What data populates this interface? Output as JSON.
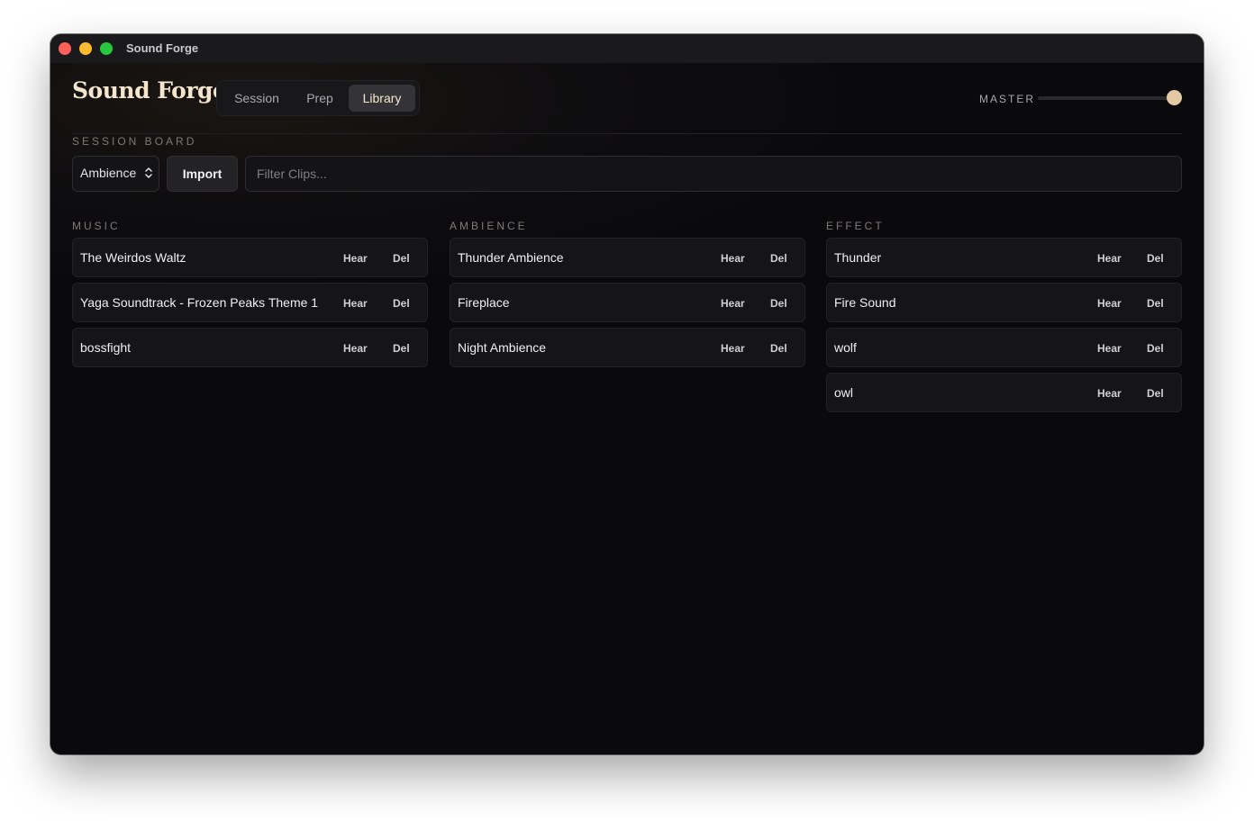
{
  "window": {
    "title": "Sound Forge"
  },
  "brand": {
    "title": "Sound Forge",
    "subtitle": "SESSION BOARD"
  },
  "tabs": [
    {
      "label": "Session",
      "active": false
    },
    {
      "label": "Prep",
      "active": false
    },
    {
      "label": "Library",
      "active": true
    }
  ],
  "master": {
    "label": "MASTER",
    "level": 1.0
  },
  "toolbar": {
    "category_select": "Ambience",
    "import_label": "Import",
    "filter_placeholder": "Filter Clips..."
  },
  "columns": [
    {
      "heading": "MUSIC",
      "clips": [
        {
          "name": "The Weirdos Waltz",
          "hear": "Hear",
          "del": "Del"
        },
        {
          "name": "Yaga Soundtrack - Frozen Peaks Theme 1",
          "hear": "Hear",
          "del": "Del"
        },
        {
          "name": "bossfight",
          "hear": "Hear",
          "del": "Del"
        }
      ]
    },
    {
      "heading": "AMBIENCE",
      "clips": [
        {
          "name": "Thunder Ambience",
          "hear": "Hear",
          "del": "Del"
        },
        {
          "name": "Fireplace",
          "hear": "Hear",
          "del": "Del"
        },
        {
          "name": "Night Ambience",
          "hear": "Hear",
          "del": "Del"
        }
      ]
    },
    {
      "heading": "EFFECT",
      "clips": [
        {
          "name": "Thunder",
          "hear": "Hear",
          "del": "Del"
        },
        {
          "name": "Fire Sound",
          "hear": "Hear",
          "del": "Del"
        },
        {
          "name": "wolf",
          "hear": "Hear",
          "del": "Del"
        },
        {
          "name": "owl",
          "hear": "Hear",
          "del": "Del"
        }
      ]
    }
  ],
  "colors": {
    "accent": "#e2c9a1",
    "background": "#0b0b0d",
    "traffic_red": "#fe5f57",
    "traffic_yellow": "#febc2e",
    "traffic_green": "#28c840"
  }
}
